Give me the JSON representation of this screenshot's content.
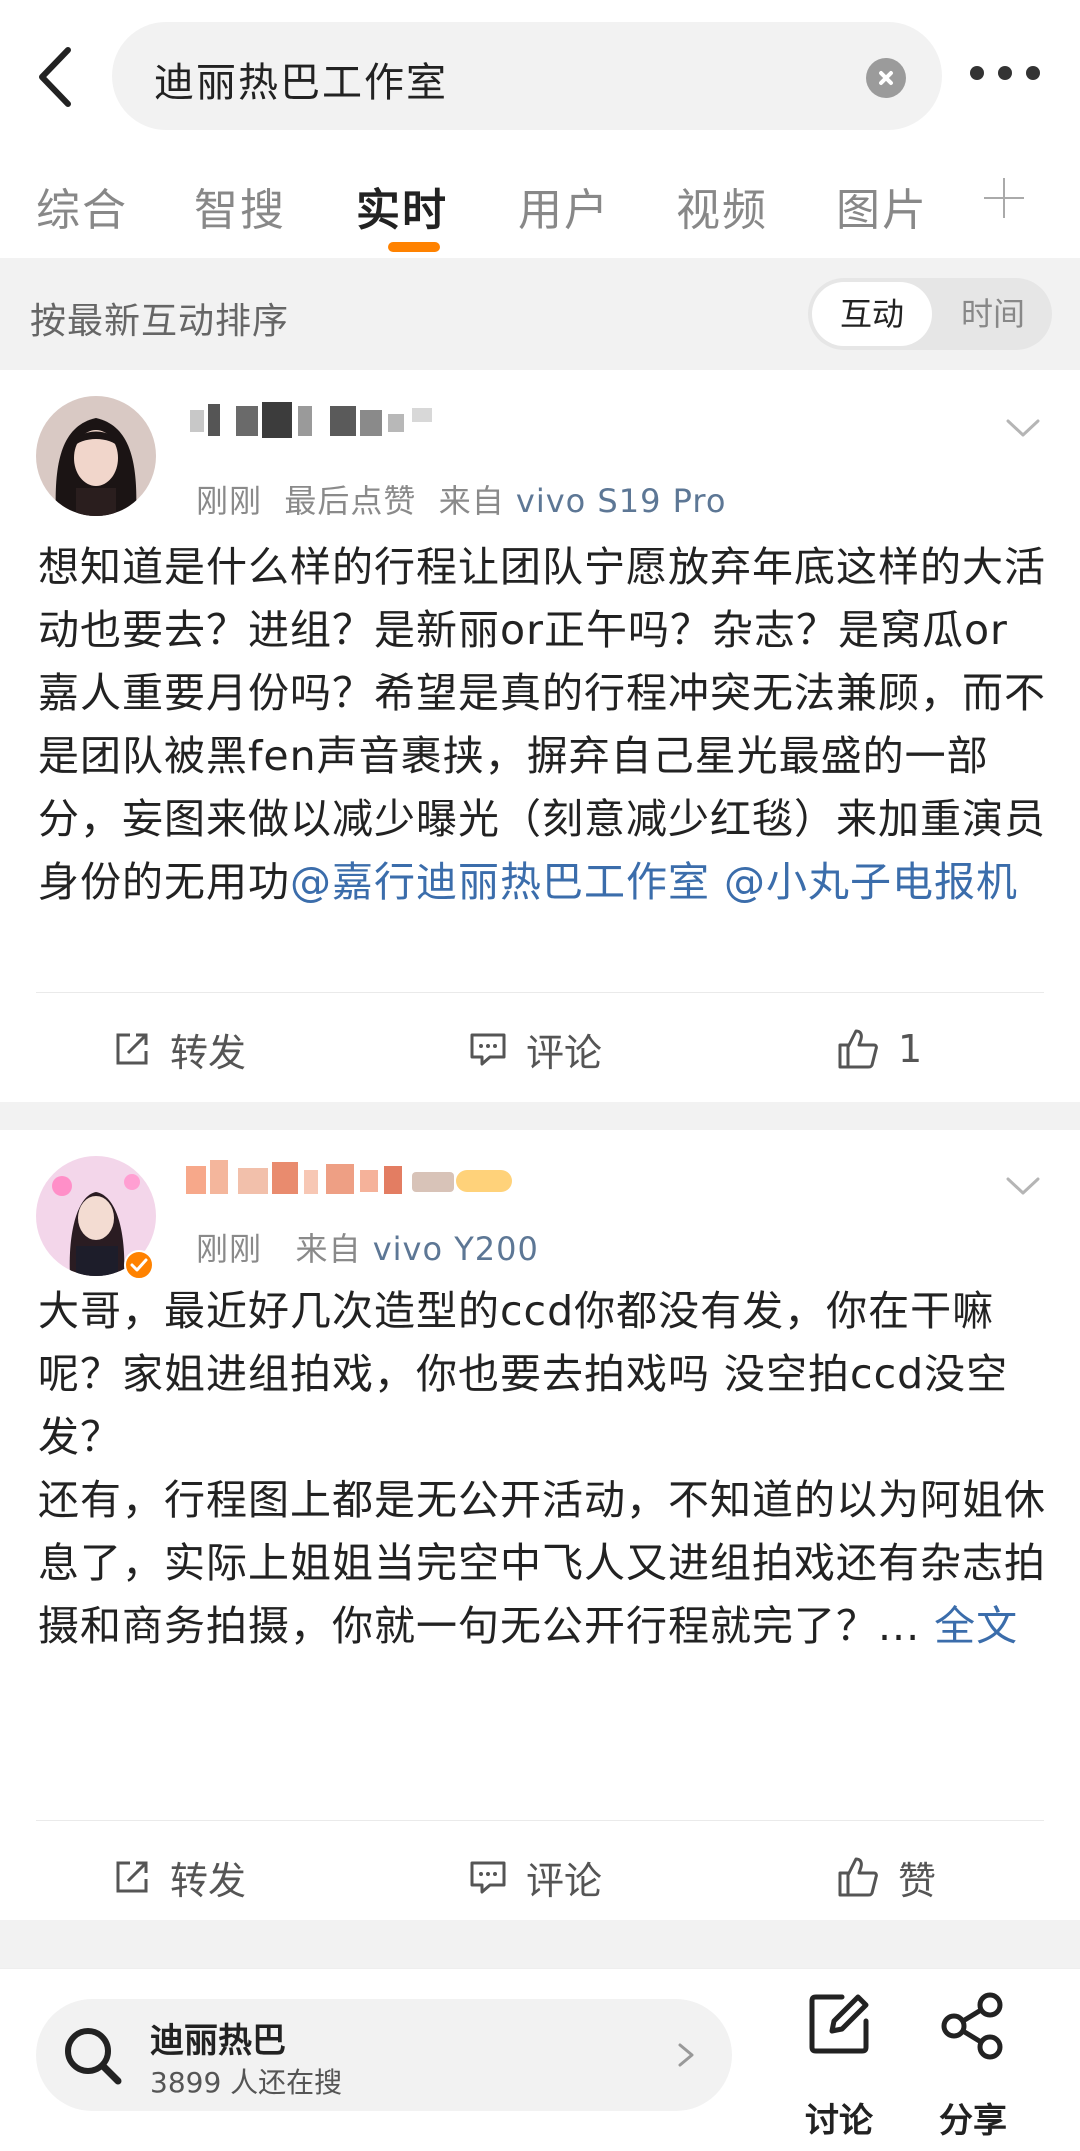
{
  "search": {
    "query": "迪丽热巴工作室"
  },
  "tabs": [
    {
      "label": "综合"
    },
    {
      "label": "智搜"
    },
    {
      "label": "实时"
    },
    {
      "label": "用户"
    },
    {
      "label": "视频"
    },
    {
      "label": "图片"
    }
  ],
  "sort": {
    "label": "按最新互动排序",
    "options": [
      "互动",
      "时间"
    ],
    "selected": "互动"
  },
  "posts": [
    {
      "meta_time": "刚刚",
      "meta_extra": "最后点赞",
      "meta_from_prefix": "来自",
      "meta_device": "vivo S19 Pro",
      "text": "想知道是什么样的行程让团队宁愿放弃年底这样的大活动也要去？进组？是新丽or正午吗？杂志？是窝瓜or嘉人重要月份吗？希望是真的行程冲突无法兼顾，而不是团队被黑fen声音裹挟，摒弃自己星光最盛的一部分，妄图来做以减少曝光（刻意减少红毯）来加重演员身份的无用功",
      "mention1": "@嘉行迪丽热巴工作室",
      "mention2": "@小丸子电报机",
      "repost": "转发",
      "comment": "评论",
      "like": "1"
    },
    {
      "meta_time": "刚刚",
      "meta_from_prefix": "来自",
      "meta_device": "vivo Y200",
      "text": "大哥，最近好几次造型的ccd你都没有发，你在干嘛呢？家姐进组拍戏，你也要去拍戏吗 没空拍ccd没空发？",
      "text2": "还有，行程图上都是无公开活动，不知道的以为阿姐休息了，实际上姐姐当完空中飞人又进组拍戏还有杂志拍摄和商务拍摄，你就一句无公开行程就完了？...",
      "more": "全文",
      "repost": "转发",
      "comment": "评论",
      "like": "赞"
    }
  ],
  "bottom": {
    "hot_title": "迪丽热巴",
    "hot_sub": "3899 人还在搜",
    "discuss": "讨论",
    "share": "分享"
  },
  "colors": {
    "accent": "#ff8200",
    "link": "#3b6dab",
    "device": "#5d7795",
    "verified": "#ff8200"
  },
  "icons": [
    "back-arrow-icon",
    "clear-icon",
    "more-icon",
    "plus-icon",
    "chevron-down-icon",
    "repost-icon",
    "comment-icon",
    "like-icon",
    "search-icon",
    "edit-icon",
    "share-icon",
    "verified-badge-icon"
  ]
}
